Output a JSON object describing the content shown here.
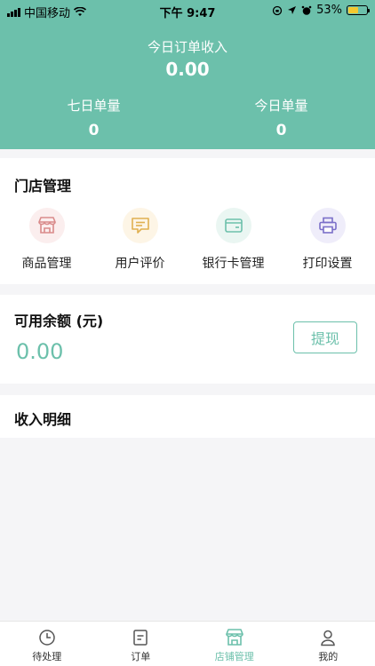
{
  "status_bar": {
    "carrier": "中国移动",
    "time": "下午 9:47",
    "battery": "53%"
  },
  "header": {
    "today_income_label": "今日订单收入",
    "today_income_value": "0.00",
    "seven_day_label": "七日单量",
    "seven_day_value": "0",
    "today_count_label": "今日单量",
    "today_count_value": "0"
  },
  "store": {
    "title": "门店管理",
    "items": [
      {
        "label": "商品管理",
        "icon": "store-icon",
        "color": "#d98b8b",
        "bg": "#fbeeee"
      },
      {
        "label": "用户评价",
        "icon": "comment-icon",
        "color": "#e0b050",
        "bg": "#fdf5e6"
      },
      {
        "label": "银行卡管理",
        "icon": "wallet-icon",
        "color": "#6cc0ab",
        "bg": "#eaf6f2"
      },
      {
        "label": "打印设置",
        "icon": "printer-icon",
        "color": "#7a6fc9",
        "bg": "#efedfa"
      }
    ]
  },
  "balance": {
    "title": "可用余额 (元)",
    "value": "0.00",
    "withdraw_label": "提现"
  },
  "income": {
    "title": "收入明细"
  },
  "tabbar": {
    "items": [
      {
        "label": "待处理",
        "icon": "clock-icon",
        "active": false
      },
      {
        "label": "订单",
        "icon": "order-icon",
        "active": false
      },
      {
        "label": "店铺管理",
        "icon": "shop-icon",
        "active": true
      },
      {
        "label": "我的",
        "icon": "user-icon",
        "active": false
      }
    ]
  },
  "colors": {
    "accent": "#6cc0ab"
  }
}
